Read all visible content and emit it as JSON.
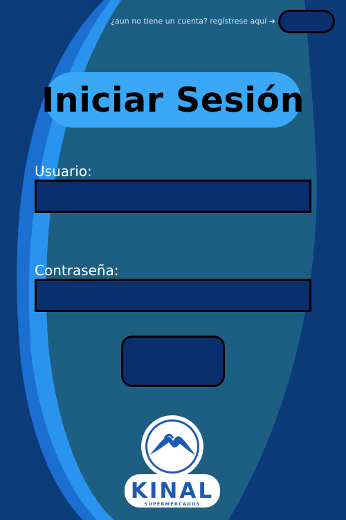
{
  "header": {
    "register_prompt": "¿aun no tiene un cuenta? regístrese aquí ➜",
    "register_button_label": ""
  },
  "login": {
    "title": "Iniciar Sesión",
    "username_label": "Usuario:",
    "username_value": "",
    "password_label": "Contraseña:",
    "password_value": "",
    "submit_label": ""
  },
  "logo": {
    "brand": "KINAL",
    "tagline": "SUPERMERCADOS"
  },
  "colors": {
    "page_background": "#0c3b7a",
    "panel": "#1d5f82",
    "swoosh_light": "#1c7de3",
    "swoosh_bright": "#2a93f0",
    "title_pill": "#3aa8f6",
    "input_fill": "#0a2f6e"
  },
  "icons": {
    "register_arrow": "arrow-right-icon",
    "logo_mark": "mountain-hand-logo"
  }
}
